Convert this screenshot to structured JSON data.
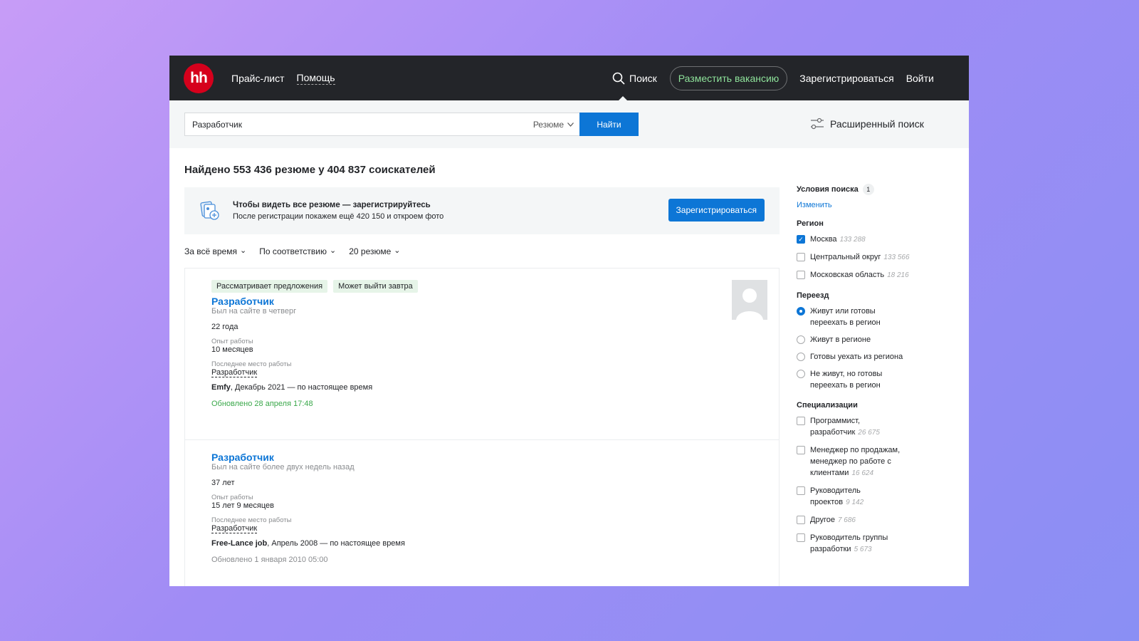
{
  "header": {
    "logo": "hh",
    "price_list": "Прайс-лист",
    "help": "Помощь",
    "search": "Поиск",
    "post_vacancy": "Разместить вакансию",
    "register": "Зарегистрироваться",
    "login": "Войти"
  },
  "search": {
    "query": "Разработчик",
    "type": "Резюме",
    "find_button": "Найти",
    "advanced": "Расширенный поиск"
  },
  "results_title": "Найдено 553 436 резюме у 404 837 соискателей",
  "promo": {
    "title": "Чтобы видеть все резюме — зарегистрируйтесь",
    "subtitle": "После регистрации покажем ещё 420 150 и откроем фото",
    "button": "Зарегистрироваться"
  },
  "filters": {
    "period": "За всё время",
    "sort": "По соответствию",
    "per_page": "20  резюме"
  },
  "resumes": [
    {
      "tags": [
        "Рассматривает предложения",
        "Может выйти завтра"
      ],
      "title": "Разработчик",
      "last_seen": "Был на сайте в четверг",
      "age": "22 года",
      "exp_label": "Опыт работы",
      "exp": "10 месяцев",
      "last_job_label": "Последнее место работы",
      "last_job": "Разработчик",
      "company": "Emfy",
      "period": ", Декабрь 2021 — по настоящее время",
      "updated": "Обновлено 28 апреля 17:48"
    },
    {
      "title": "Разработчик",
      "last_seen": "Был на сайте более двух недель назад",
      "age": "37 лет",
      "exp_label": "Опыт работы",
      "exp": "15 лет 9 месяцев",
      "last_job_label": "Последнее место работы",
      "last_job": "Разработчик",
      "company": "Free-Lance job",
      "period": ", Апрель 2008 — по настоящее время",
      "updated": "Обновлено 1 января 2010 05:00"
    }
  ],
  "sidebar": {
    "conditions": {
      "title": "Условия поиска",
      "count": "1",
      "change": "Изменить"
    },
    "region": {
      "title": "Регион",
      "items": [
        {
          "label": "Москва",
          "count": "133 288",
          "checked": true
        },
        {
          "label": "Центральный округ",
          "count": "133 566",
          "checked": false
        },
        {
          "label": "Московская область",
          "count": "18 216",
          "checked": false
        }
      ]
    },
    "relocation": {
      "title": "Переезд",
      "items": [
        {
          "label": "Живут или готовы переехать в регион",
          "selected": true
        },
        {
          "label": "Живут в регионе",
          "selected": false
        },
        {
          "label": "Готовы уехать из региона",
          "selected": false
        },
        {
          "label": "Не живут, но готовы переехать в регион",
          "selected": false
        }
      ]
    },
    "specializations": {
      "title": "Специализации",
      "items": [
        {
          "label": "Программист, разработчик",
          "count": "26 675"
        },
        {
          "label": "Менеджер по продажам, менеджер по работе с клиентами",
          "count": "16 624"
        },
        {
          "label": "Руководитель проектов",
          "count": "9 142"
        },
        {
          "label": "Другое",
          "count": "7 686"
        },
        {
          "label": "Руководитель группы разработки",
          "count": "5 673"
        }
      ]
    }
  }
}
